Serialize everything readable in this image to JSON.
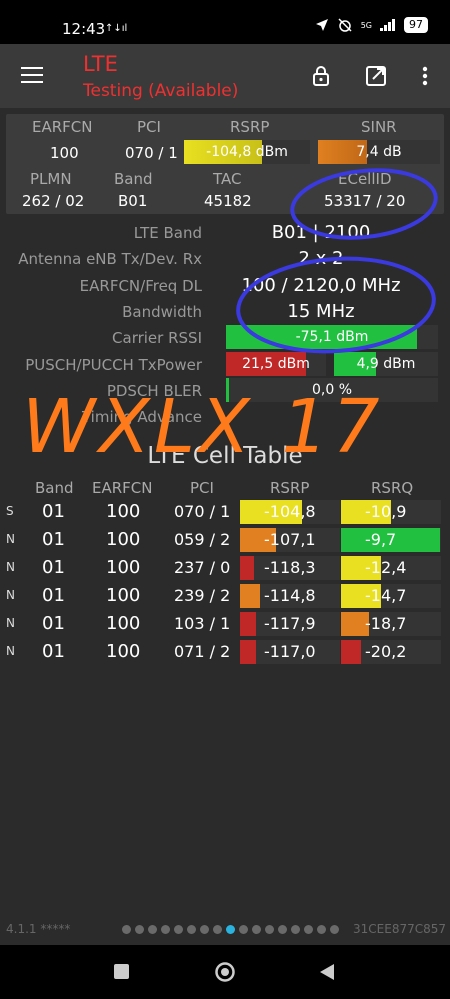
{
  "status": {
    "time": "12:43",
    "signal_tag": "↑↓ıl",
    "net": "5G",
    "battery": "97"
  },
  "toolbar": {
    "title": "LTE",
    "subtitle": "Testing (Available)"
  },
  "panel": {
    "headers": {
      "earfcn": "EARFCN",
      "pci": "PCI",
      "rsrp": "RSRP",
      "sinr": "SINR",
      "plmn": "PLMN",
      "band": "Band",
      "tac": "TAC",
      "ecellid": "ECellID"
    },
    "earfcn": "100",
    "pci": "070 / 1",
    "rsrp": "-104,8 dBm",
    "rsrp_level": 0.62,
    "sinr": "7,4 dB",
    "sinr_level": 0.4,
    "plmn": "262 / 02",
    "band": "B01",
    "tac": "45182",
    "ecellid": "53317 / 20"
  },
  "details": {
    "lte_band_label": "LTE Band",
    "lte_band": "B01 | 2100",
    "antenna_label": "Antenna eNB Tx/Dev. Rx",
    "antenna": "2 x 2",
    "earfcn_freq_label": "EARFCN/Freq DL",
    "earfcn_freq": "100 / 2120,0 MHz",
    "bandwidth_label": "Bandwidth",
    "bandwidth": "15 MHz",
    "rssi_label": "Carrier RSSI",
    "rssi": "-75,1 dBm",
    "rssi_level": 0.9,
    "txpower_label": "PUSCH/PUCCH TxPower",
    "pusch": "21,5 dBm",
    "pusch_level": 0.8,
    "pucch": "4,9 dBm",
    "pucch_level": 0.4,
    "bler_label": "PDSCH BLER",
    "bler": "0,0 %",
    "bler_level": 0.0,
    "ta_label": "Timing Advance"
  },
  "annotation_text": "WXLX 17",
  "cell_table": {
    "title": "LTE Cell Table",
    "headers": {
      "band": "Band",
      "earfcn": "EARFCN",
      "pci": "PCI",
      "rsrp": "RSRP",
      "rsrq": "RSRQ"
    },
    "rows": [
      {
        "type": "S",
        "band": "01",
        "earfcn": "100",
        "pci": "070 / 1",
        "rsrp": "-104,8",
        "rsrp_level": 0.62,
        "rsrp_color": "#e8e020",
        "rsrq": "-10,9",
        "rsrq_level": 0.5,
        "rsrq_color": "#e8e020"
      },
      {
        "type": "N",
        "band": "01",
        "earfcn": "100",
        "pci": "059 / 2",
        "rsrp": "-107,1",
        "rsrp_level": 0.36,
        "rsrp_color": "#e08020",
        "rsrq": "-9,7",
        "rsrq_level": 0.99,
        "rsrq_color": "#22c040"
      },
      {
        "type": "N",
        "band": "01",
        "earfcn": "100",
        "pci": "237 / 0",
        "rsrp": "-118,3",
        "rsrp_level": 0.14,
        "rsrp_color": "#c02828",
        "rsrq": "-12,4",
        "rsrq_level": 0.4,
        "rsrq_color": "#e8e020"
      },
      {
        "type": "N",
        "band": "01",
        "earfcn": "100",
        "pci": "239 / 2",
        "rsrp": "-114,8",
        "rsrp_level": 0.2,
        "rsrp_color": "#e08020",
        "rsrq": "-14,7",
        "rsrq_level": 0.4,
        "rsrq_color": "#e8e020"
      },
      {
        "type": "N",
        "band": "01",
        "earfcn": "100",
        "pci": "103 / 1",
        "rsrp": "-117,9",
        "rsrp_level": 0.16,
        "rsrp_color": "#c02828",
        "rsrq": "-18,7",
        "rsrq_level": 0.28,
        "rsrq_color": "#e08020"
      },
      {
        "type": "N",
        "band": "01",
        "earfcn": "100",
        "pci": "071 / 2",
        "rsrp": "-117,0",
        "rsrp_level": 0.16,
        "rsrp_color": "#c02828",
        "rsrq": "-20,2",
        "rsrq_level": 0.2,
        "rsrq_color": "#c02828"
      }
    ]
  },
  "footer": {
    "version": "4.1.1 *****",
    "device_id": "31CEE877C857",
    "pages": 17,
    "active_page": 8
  },
  "colors": {
    "accent": "#f03030",
    "green": "#22c040",
    "yellow": "#e8e020",
    "orange": "#e08020",
    "red": "#c02828",
    "annotation_orange": "#ff7a1a",
    "annotation_blue": "#3a3ae0"
  }
}
